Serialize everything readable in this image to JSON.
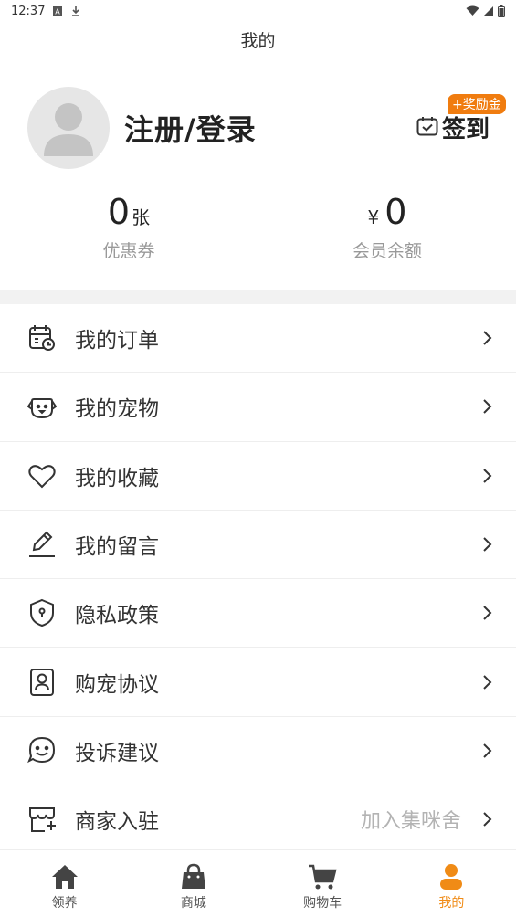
{
  "status_bar": {
    "time": "12:37"
  },
  "header": {
    "title": "我的"
  },
  "profile": {
    "login_label": "注册/登录",
    "checkin_label": "签到",
    "reward_badge": "+奖励金",
    "coupons": {
      "value": "0",
      "unit": "张",
      "label": "优惠券"
    },
    "balance": {
      "prefix": "¥",
      "value": "0",
      "label": "会员余额"
    }
  },
  "menu": [
    {
      "label": "我的订单",
      "icon": "calendar-clock-icon"
    },
    {
      "label": "我的宠物",
      "icon": "dog-face-icon"
    },
    {
      "label": "我的收藏",
      "icon": "heart-icon"
    },
    {
      "label": "我的留言",
      "icon": "pen-icon"
    },
    {
      "label": "隐私政策",
      "icon": "shield-keyhole-icon"
    },
    {
      "label": "购宠协议",
      "icon": "person-badge-icon"
    },
    {
      "label": "投诉建议",
      "icon": "smile-chat-icon"
    },
    {
      "label": "商家入驻",
      "icon": "storefront-icon",
      "extra": "加入集咪舍"
    }
  ],
  "tabs": [
    {
      "label": "领养",
      "icon": "home-icon",
      "active": false
    },
    {
      "label": "商城",
      "icon": "shopping-bag-icon",
      "active": false
    },
    {
      "label": "购物车",
      "icon": "cart-icon",
      "active": false
    },
    {
      "label": "我的",
      "icon": "person-icon",
      "active": true
    }
  ],
  "colors": {
    "accent": "#f08b16",
    "badge": "#f07c0f",
    "tab_inactive": "#555555",
    "divider_band": "#f2f2f2"
  }
}
